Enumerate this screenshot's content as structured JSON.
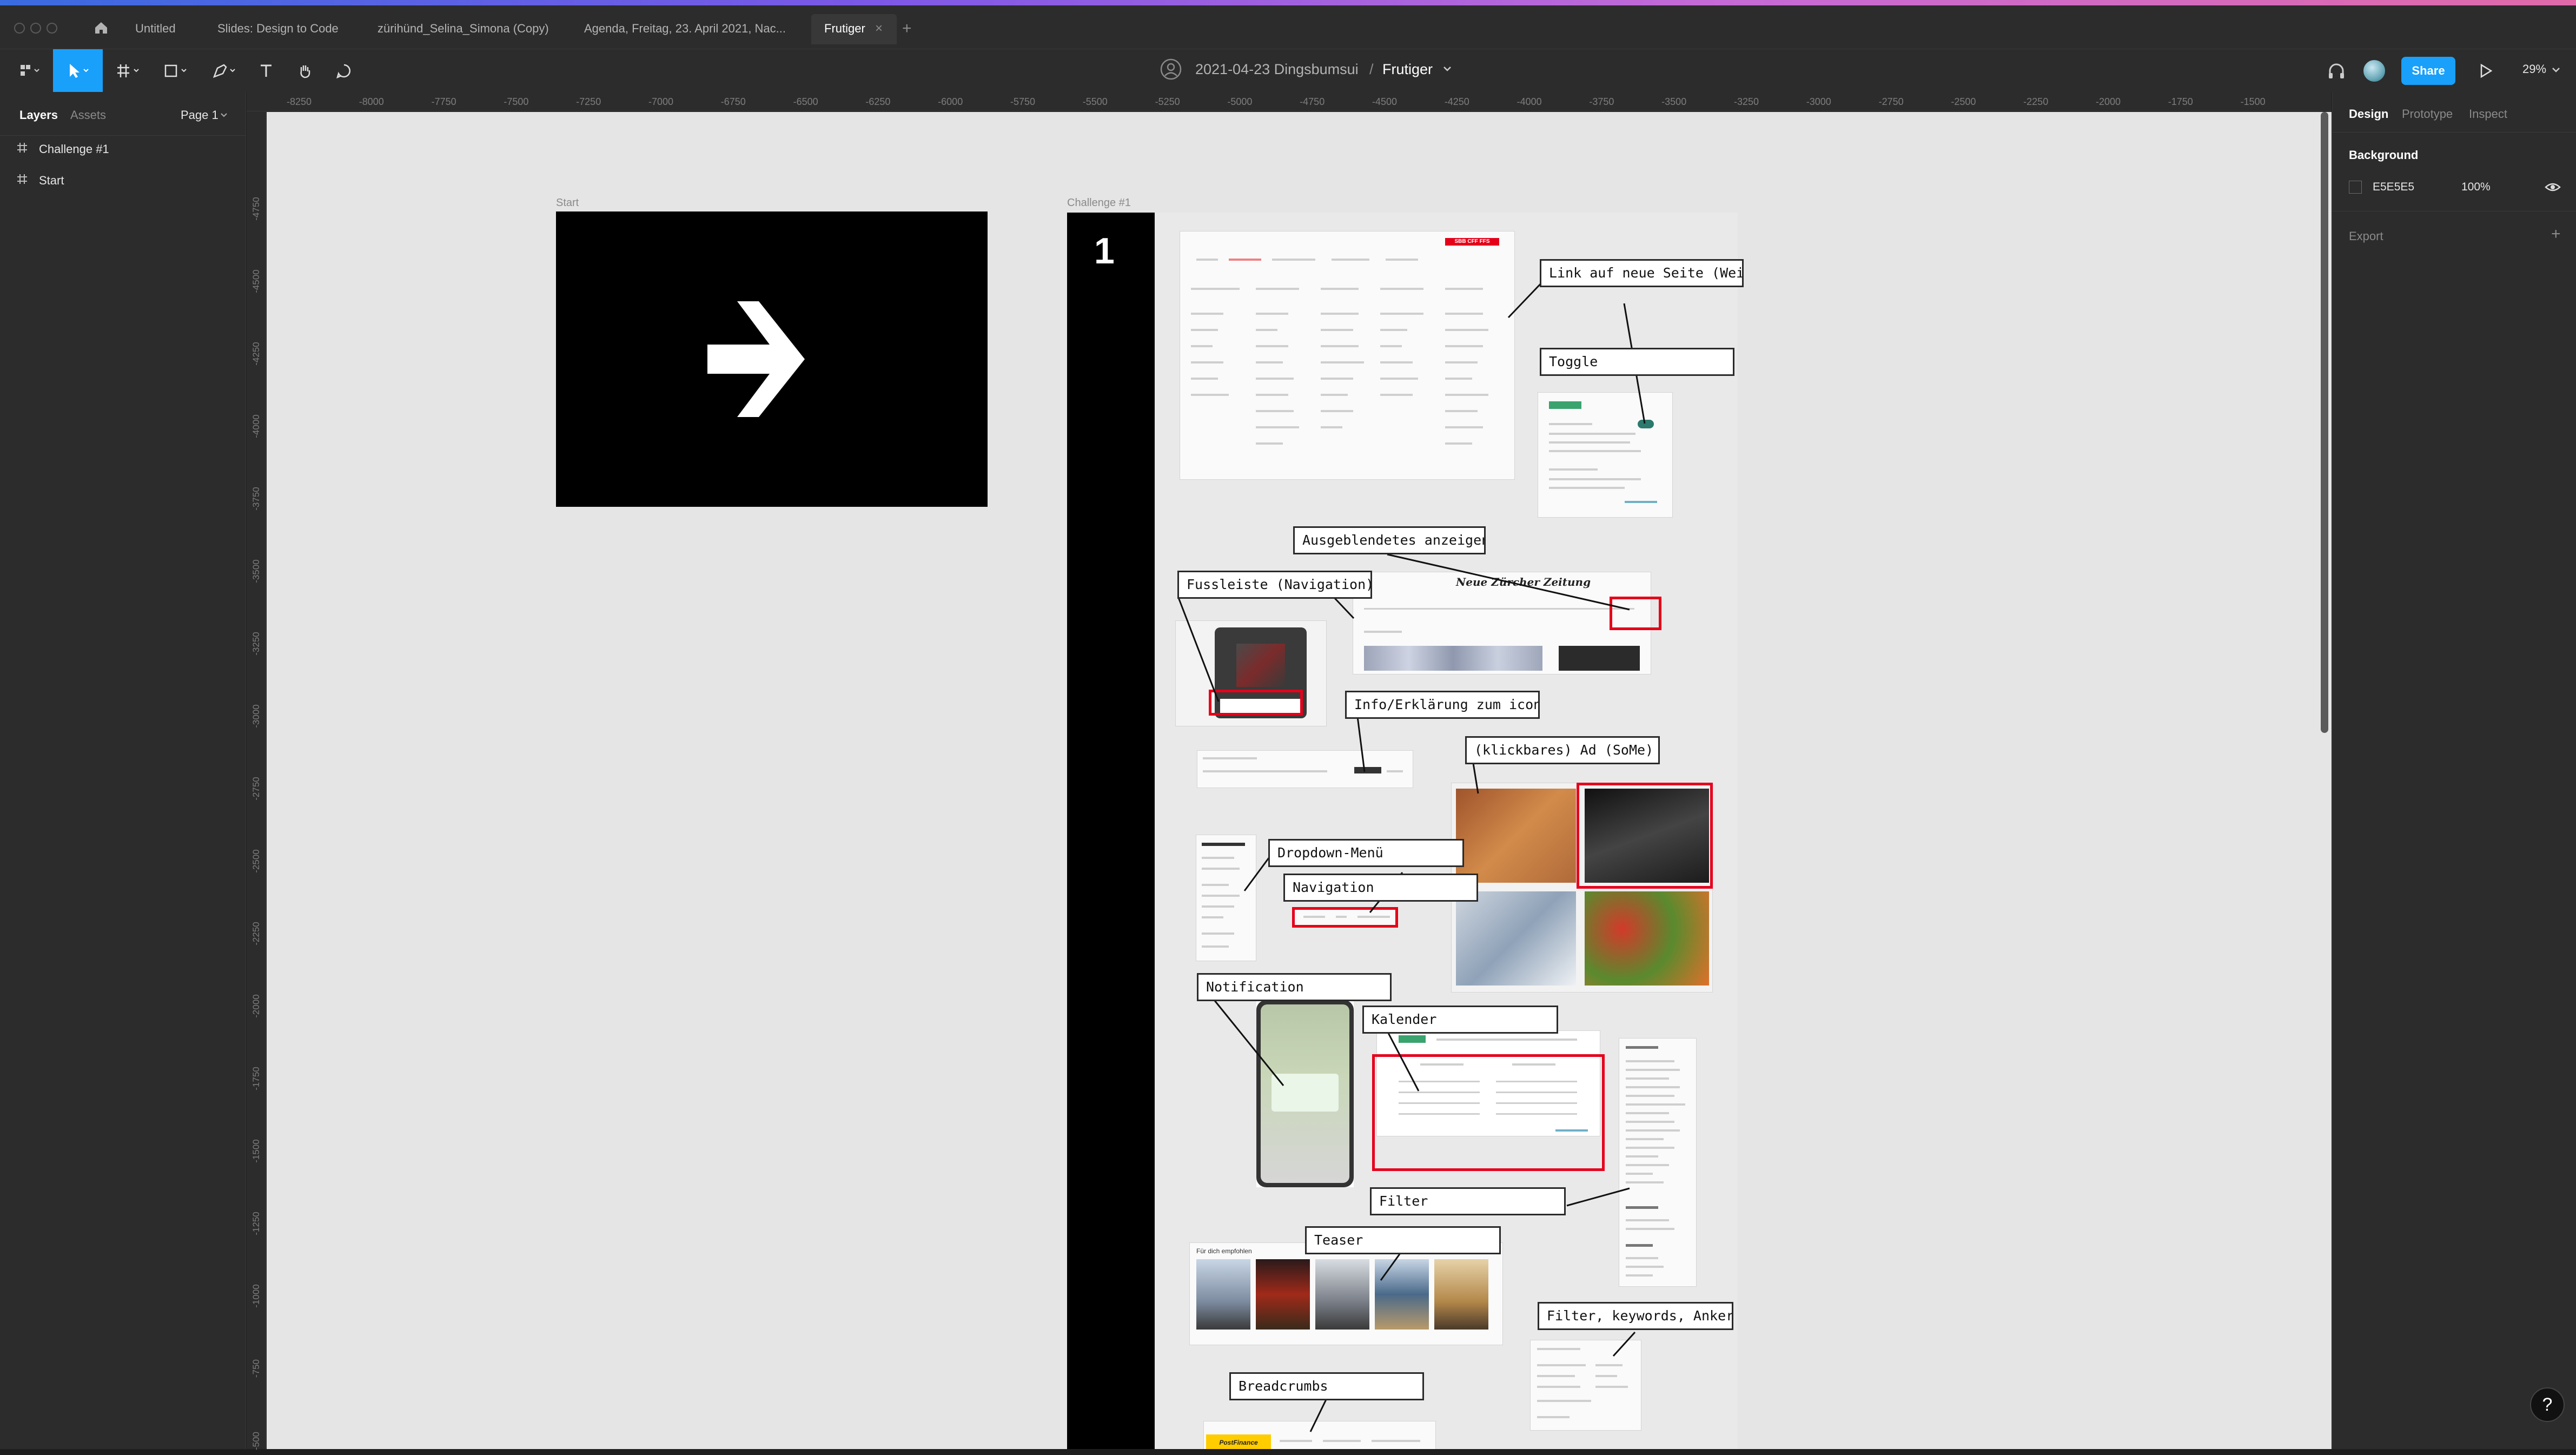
{
  "tabs": {
    "items": [
      {
        "label": "Untitled"
      },
      {
        "label": "Slides: Design to Code"
      },
      {
        "label": "zürihünd_Selina_Simona (Copy)"
      },
      {
        "label": "Agenda, Freitag, 23. April 2021, Nac..."
      },
      {
        "label": "Frutiger"
      }
    ],
    "active_index": 4
  },
  "toolbar": {
    "file_name": "2021-04-23 Dingsbumsui",
    "separator": "/",
    "page_name": "Frutiger",
    "share_label": "Share",
    "zoom": "29%",
    "accent_color": "#18a0fb"
  },
  "left_panel": {
    "tab_layers": "Layers",
    "tab_assets": "Assets",
    "page_select": "Page 1",
    "layers": [
      {
        "label": "Challenge #1",
        "icon": "frame-icon"
      },
      {
        "label": "Start",
        "icon": "frame-icon"
      }
    ]
  },
  "right_panel": {
    "tab_design": "Design",
    "tab_prototype": "Prototype",
    "tab_inspect": "Inspect",
    "background_heading": "Background",
    "background_hex": "E5E5E5",
    "background_opacity": "100%",
    "background_color": "#e5e5e5",
    "export_heading": "Export"
  },
  "rulers": {
    "h": [
      "-8250",
      "-8000",
      "-7750",
      "-7500",
      "-7250",
      "-7000",
      "-6750",
      "-6500",
      "-6250",
      "-6000",
      "-5750",
      "-5500",
      "-5250",
      "-5000",
      "-4750",
      "-4500",
      "-4250",
      "-4000",
      "-3750",
      "-3500",
      "-3250",
      "-3000",
      "-2750",
      "-2500",
      "-2250",
      "-2000",
      "-1750",
      "-1500"
    ],
    "v": [
      "-4750",
      "-4500",
      "-4250",
      "-4000",
      "-3750",
      "-3500",
      "-3250",
      "-3000",
      "-2750",
      "-2500",
      "-2250",
      "-2000",
      "-1750",
      "-1500",
      "-1250",
      "-1000",
      "-750",
      "-500"
    ]
  },
  "canvas": {
    "start_frame_label": "Start",
    "challenge_frame_label": "Challenge #1",
    "challenge_number": "1",
    "callouts": [
      "Link auf neue Seite (Weite",
      "Toggle",
      "Ausgeblendetes anzeigen",
      "Fussleiste (Navigation)",
      "Info/Erklärung zum icon",
      "(klickbares) Ad (SoMe)",
      "Dropdown-Menü",
      "Navigation",
      "Notification",
      "Kalender",
      "Filter",
      "Teaser",
      "Filter, keywords, Ankers",
      "Breadcrumbs"
    ],
    "thumb_texts": {
      "nzz_title": "Neue Zürcher Zeitung",
      "sbb_badge": "SBB CFF FFS",
      "teaser_heading": "Für dich empfohlen",
      "postfinance": "PostFinance"
    }
  },
  "help_label": "?"
}
